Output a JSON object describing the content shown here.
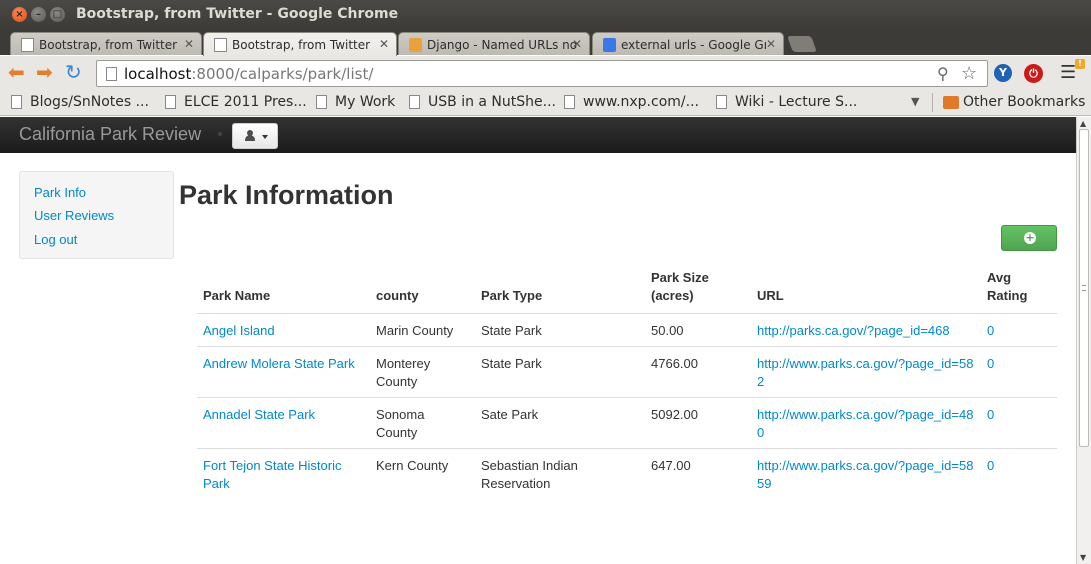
{
  "window": {
    "title": "Bootstrap, from Twitter - Google Chrome"
  },
  "tabs": [
    {
      "label": "Bootstrap, from Twitter",
      "active": false
    },
    {
      "label": "Bootstrap, from Twitter",
      "active": true
    },
    {
      "label": "Django - Named URLs not",
      "active": false
    },
    {
      "label": "external urls - Google Gro",
      "active": false
    }
  ],
  "toolbar": {
    "url_host": "localhost",
    "url_rest": ":8000/calparks/park/list/"
  },
  "bookmarks": {
    "items": [
      "Blogs/SnNotes ...",
      "ELCE 2011 Pres...",
      "My Work",
      "USB in a NutShe...",
      "www.nxp.com/...",
      "Wiki - Lecture S..."
    ],
    "other": "Other Bookmarks"
  },
  "navbar": {
    "brand": "California Park Review"
  },
  "sidebar": {
    "items": [
      "Park Info",
      "User Reviews",
      "Log out"
    ]
  },
  "main": {
    "title": "Park Information",
    "add_icon": "plus-sign-icon"
  },
  "table": {
    "headers": {
      "name": "Park Name",
      "county": "county",
      "type": "Park Type",
      "size_line1": "Park Size",
      "size_line2": "(acres)",
      "url": "URL",
      "rating_line1": "Avg",
      "rating_line2": "Rating"
    },
    "rows": [
      {
        "name": "Angel Island",
        "county": "Marin County",
        "type": "State Park",
        "size": "50.00",
        "url": "http://parks.ca.gov/?page_id=468",
        "rating": "0"
      },
      {
        "name": "Andrew Molera State Park",
        "county": "Monterey County",
        "type": "State Park",
        "size": "4766.00",
        "url": "http://www.parks.ca.gov/?page_id=582",
        "rating": "0"
      },
      {
        "name": "Annadel State Park",
        "county": "Sonoma County",
        "type": "Sate Park",
        "size": "5092.00",
        "url": "http://www.parks.ca.gov/?page_id=480",
        "rating": "0"
      },
      {
        "name": "Fort Tejon State Historic Park",
        "county": "Kern County",
        "type": "Sebastian Indian Reservation",
        "size": "647.00",
        "url": "http://www.parks.ca.gov/?page_id=5859",
        "rating": "0"
      }
    ]
  },
  "colors": {
    "link": "#0088cc",
    "navbar": "#222222",
    "success": "#51a351"
  }
}
